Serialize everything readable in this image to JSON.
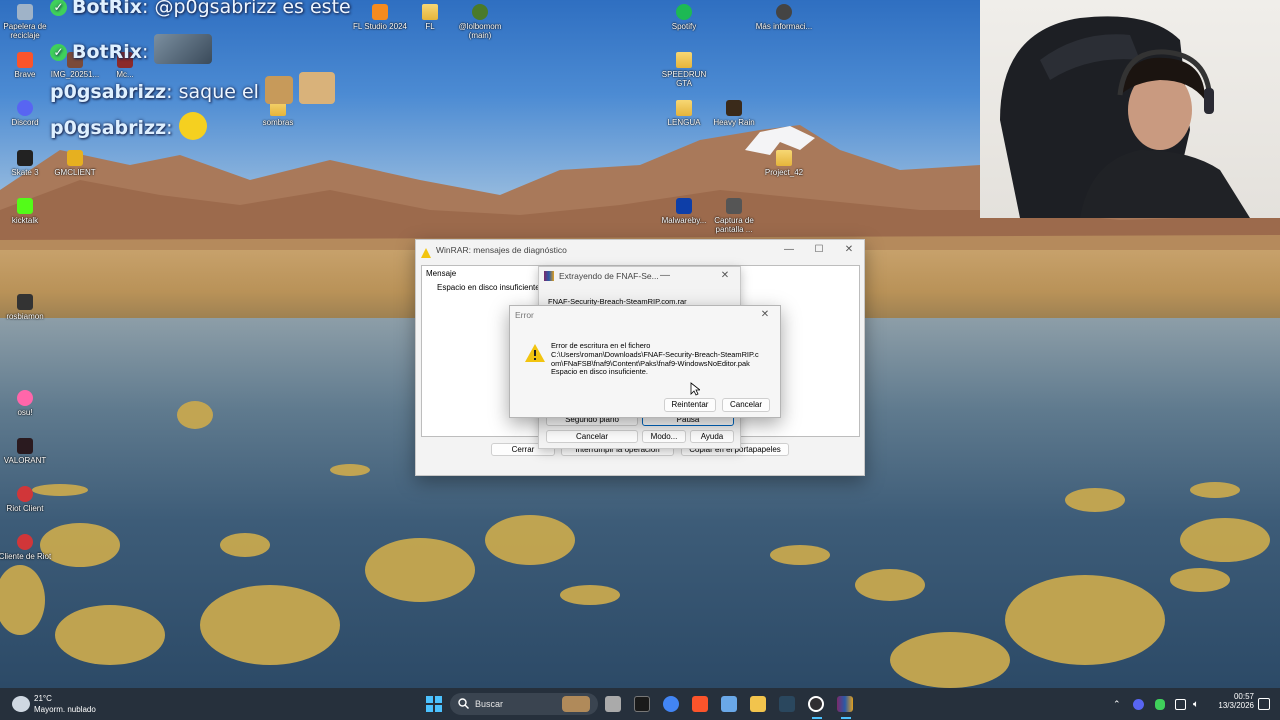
{
  "desktop_icons": [
    {
      "label": "Papelera de reciclaje"
    },
    {
      "label": "Brave"
    },
    {
      "label": "IMG_20251..."
    },
    {
      "label": "Mc..."
    },
    {
      "label": "Discord"
    },
    {
      "label": "Skate 3"
    },
    {
      "label": "GMCLIENT"
    },
    {
      "label": "kicktalk"
    },
    {
      "label": "rosbiamon"
    },
    {
      "label": "osu!"
    },
    {
      "label": "VALORANT"
    },
    {
      "label": "Riot Client"
    },
    {
      "label": "Cliente de Riot"
    },
    {
      "label": "FL Studio 2024"
    },
    {
      "label": "FL"
    },
    {
      "label": "@lolbomom (main)"
    },
    {
      "label": "sombras"
    },
    {
      "label": "Spotify"
    },
    {
      "label": "SPEEDRUN GTA"
    },
    {
      "label": "LENGUA"
    },
    {
      "label": "Heavy Rain"
    },
    {
      "label": "Malwareby..."
    },
    {
      "label": "Captura de pantalla ..."
    },
    {
      "label": "Más informaci..."
    },
    {
      "label": "Project_42"
    }
  ],
  "chat": [
    {
      "user": "BotRix",
      "message": ": @p0gsabrizz es este"
    },
    {
      "user": "BotRix",
      "message": ":"
    },
    {
      "user": "p0gsabrizz",
      "message": ": saque el"
    },
    {
      "user": "p0gsabrizz",
      "message": ":"
    }
  ],
  "diag_window": {
    "title": "WinRAR: mensajes de diagnóstico",
    "list_header": "Mensaje",
    "list_item": "Espacio en disco insuficiente.",
    "buttons": [
      "Cerrar",
      "Interrumpir la operación",
      "Copiar en el portapapeles"
    ]
  },
  "extract_window": {
    "title": "Extrayendo de FNAF-Se...",
    "archive": "FNAF-Security-Breach-SteamRIP.com.rar",
    "buttons": [
      "Segundo plano",
      "Pausa",
      "Cancelar",
      "Modo...",
      "Ayuda"
    ]
  },
  "error_dialog": {
    "title": "Error",
    "line1": "Error de escritura en el fichero",
    "line2": "C:\\Users\\roman\\Downloads\\FNAF-Security-Breach-SteamRIP.c",
    "line3": "om\\FNaFSB\\fnaf9\\Content\\Paks\\fnaf9-WindowsNoEditor.pak",
    "line4": "Espacio en disco insuficiente.",
    "retry": "Reintentar",
    "cancel": "Cancelar"
  },
  "taskbar": {
    "weather_temp": "21°C",
    "weather_desc": "Mayorm. nublado",
    "search_placeholder": "Buscar",
    "time": "00:57",
    "date": "13/3/2026"
  },
  "colors": {
    "accent": "#0067c0",
    "warning": "#f2c40f",
    "chat_badge": "#3fd05b"
  }
}
